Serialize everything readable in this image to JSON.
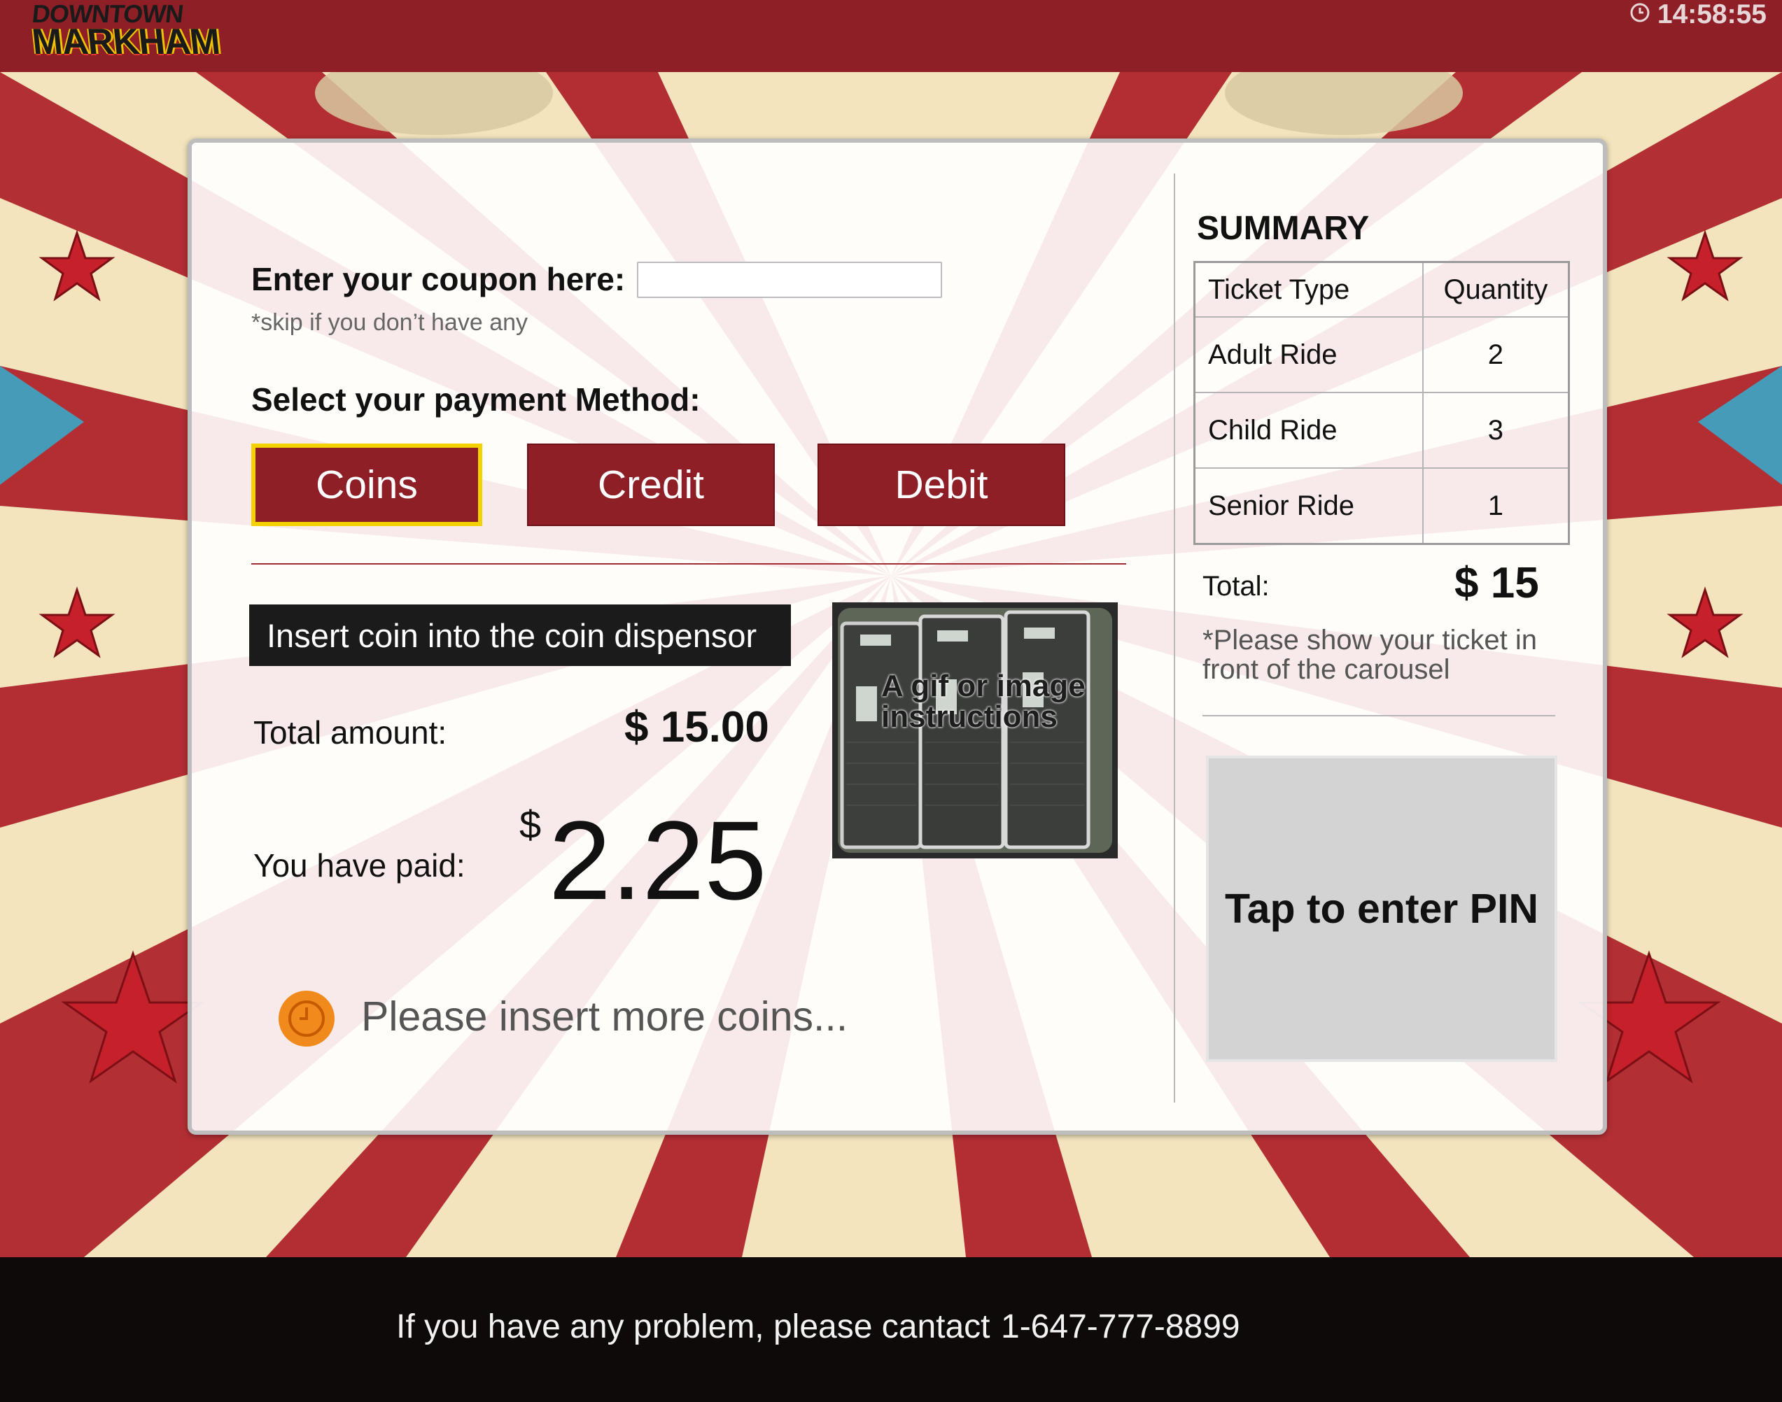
{
  "header": {
    "logo_line1": "DOWNTOWN",
    "logo_line2": "MARKHAM",
    "clock_icon": "clock-icon",
    "time": "14:58:55"
  },
  "colors": {
    "brand": "#8e1f27",
    "selected_border": "#f4d200",
    "status_icon": "#f08a1c"
  },
  "coupon": {
    "label": "Enter your coupon here:",
    "hint": "*skip if you don’t have any",
    "value": "",
    "placeholder": ""
  },
  "payment": {
    "label": "Select your payment Method:",
    "methods": [
      "Coins",
      "Credit",
      "Debit"
    ],
    "selected": "Coins"
  },
  "coins": {
    "banner": "Insert coin into the coin dispensor",
    "total_label": "Total amount:",
    "total_value": "$ 15.00",
    "paid_label": "You have paid:",
    "paid_currency": "$",
    "paid_value": "2.25",
    "instructions_caption": "A gif or image instructions",
    "status_icon": "clock-icon",
    "status_text": "Please insert more coins..."
  },
  "summary": {
    "title": "SUMMARY",
    "columns": [
      "Ticket Type",
      "Quantity"
    ],
    "rows": [
      {
        "type": "Adult Ride",
        "qty": "2"
      },
      {
        "type": "Child Ride",
        "qty": "3"
      },
      {
        "type": "Senior Ride",
        "qty": "1"
      }
    ],
    "total_label": "Total:",
    "total_value": "$ 15",
    "note": "*Please show your ticket in front of the carousel",
    "pin_button": "Tap to enter PIN"
  },
  "footer": {
    "text": "If you have any problem, please cantact",
    "phone": "1-647-777-8899"
  }
}
